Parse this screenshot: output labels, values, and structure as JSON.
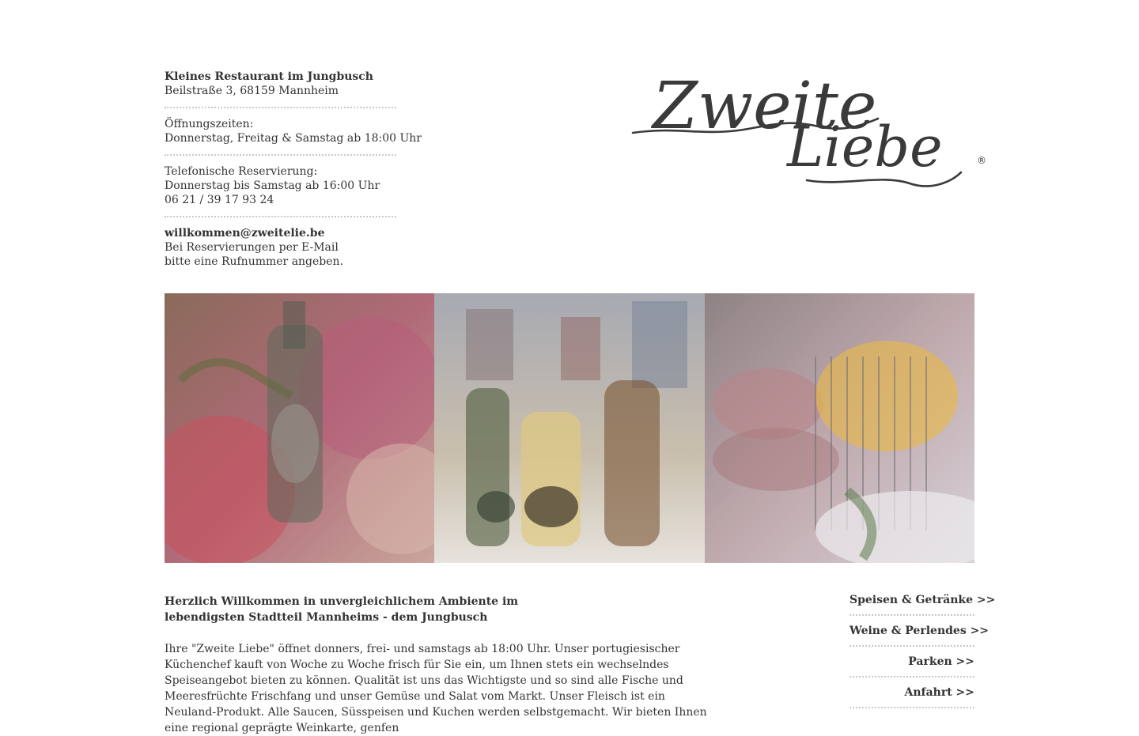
{
  "info": {
    "restaurant_name": "Kleines Restaurant im Jungbusch",
    "address": "Beilstraße 3, 68159 Mannheim",
    "hours_label": "Öffnungszeiten:",
    "hours_value": "Donnerstag, Freitag & Samstag ab 18:00 Uhr",
    "reservation_label": "Telefonische Reservierung:",
    "reservation_hours": "Donnerstag bis Samstag ab 16:00 Uhr",
    "phone": "06 21 / 39 17 93 24",
    "email": "willkommen@zweitelie.be",
    "email_note_1": "Bei Reservierungen per E-Mail",
    "email_note_2": "bitte eine Rufnummer angeben."
  },
  "logo": {
    "line1": "Zweite",
    "line2": "Liebe",
    "registered": "®"
  },
  "intro": {
    "headline_1": "Herzlich Willkommen in unvergleichlichem Ambiente im",
    "headline_2": "lebendigsten Stadtteil Mannheims - dem Jungbusch",
    "body": "Ihre \"Zweite Liebe\" öffnet donners, frei- und samstags ab 18:00 Uhr. Unser portugiesischer Küchenchef kauft von Woche zu Woche frisch für Sie ein, um Ihnen stets ein wechselndes Speiseangebot bieten zu können. Qualität ist uns das Wichtigste und so sind alle Fische und Meeresfrüchte Frischfang und unser Gemüse und Salat vom Markt. Unser Fleisch ist ein Neuland-Produkt. Alle Saucen, Süsspeisen und Kuchen werden selbstgemacht. Wir bieten Ihnen eine regional geprägte Weinkarte, genfen"
  },
  "nav": {
    "items": [
      {
        "label": "Speisen & Getränke >>"
      },
      {
        "label": "Weine & Perlendes >>"
      },
      {
        "label": "Parken >>"
      },
      {
        "label": "Anfahrt >>"
      }
    ]
  },
  "colors": {
    "text": "#333333",
    "divider": "#c8c8c8",
    "logo": "#3a3a3a"
  }
}
